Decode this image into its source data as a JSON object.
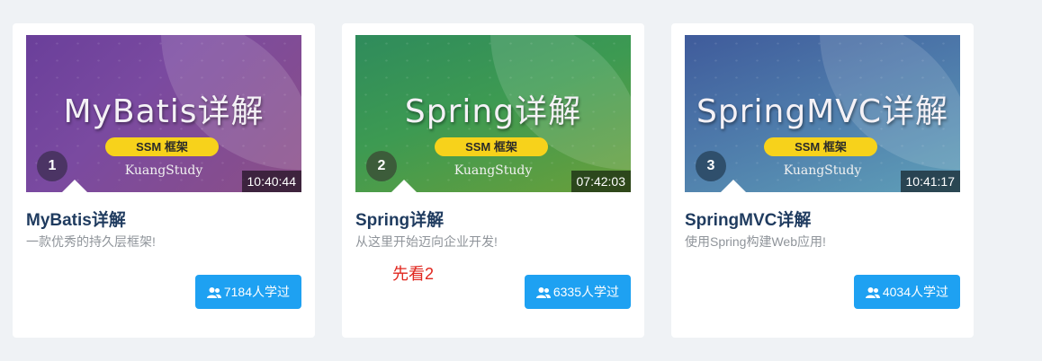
{
  "courses": [
    {
      "thumb_title": "MyBatis详解",
      "thumb_tag": "SSM 框架",
      "thumb_brand": "KuangStudy",
      "number": "1",
      "duration": "10:40:44",
      "title": "MyBatis详解",
      "description": "一款优秀的持久层框架!",
      "learners": "7184人学过",
      "icon": "users-icon"
    },
    {
      "thumb_title": "Spring详解",
      "thumb_tag": "SSM 框架",
      "thumb_brand": "KuangStudy",
      "number": "2",
      "duration": "07:42:03",
      "title": "Spring详解",
      "description": "从这里开始迈向企业开发!",
      "learners": "6335人学过",
      "icon": "users-icon",
      "note": "先看2"
    },
    {
      "thumb_title": "SpringMVC详解",
      "thumb_tag": "SSM 框架",
      "thumb_brand": "KuangStudy",
      "number": "3",
      "duration": "10:41:17",
      "title": "SpringMVC详解",
      "description": "使用Spring构建Web应用!",
      "learners": "4034人学过",
      "icon": "users-icon"
    }
  ],
  "colors": {
    "page_background": "#eff2f5",
    "button_blue": "#1ea1f2",
    "title_color": "#1f3b5f",
    "note_red": "#e0261e",
    "tag_yellow": "#f7d21b"
  }
}
